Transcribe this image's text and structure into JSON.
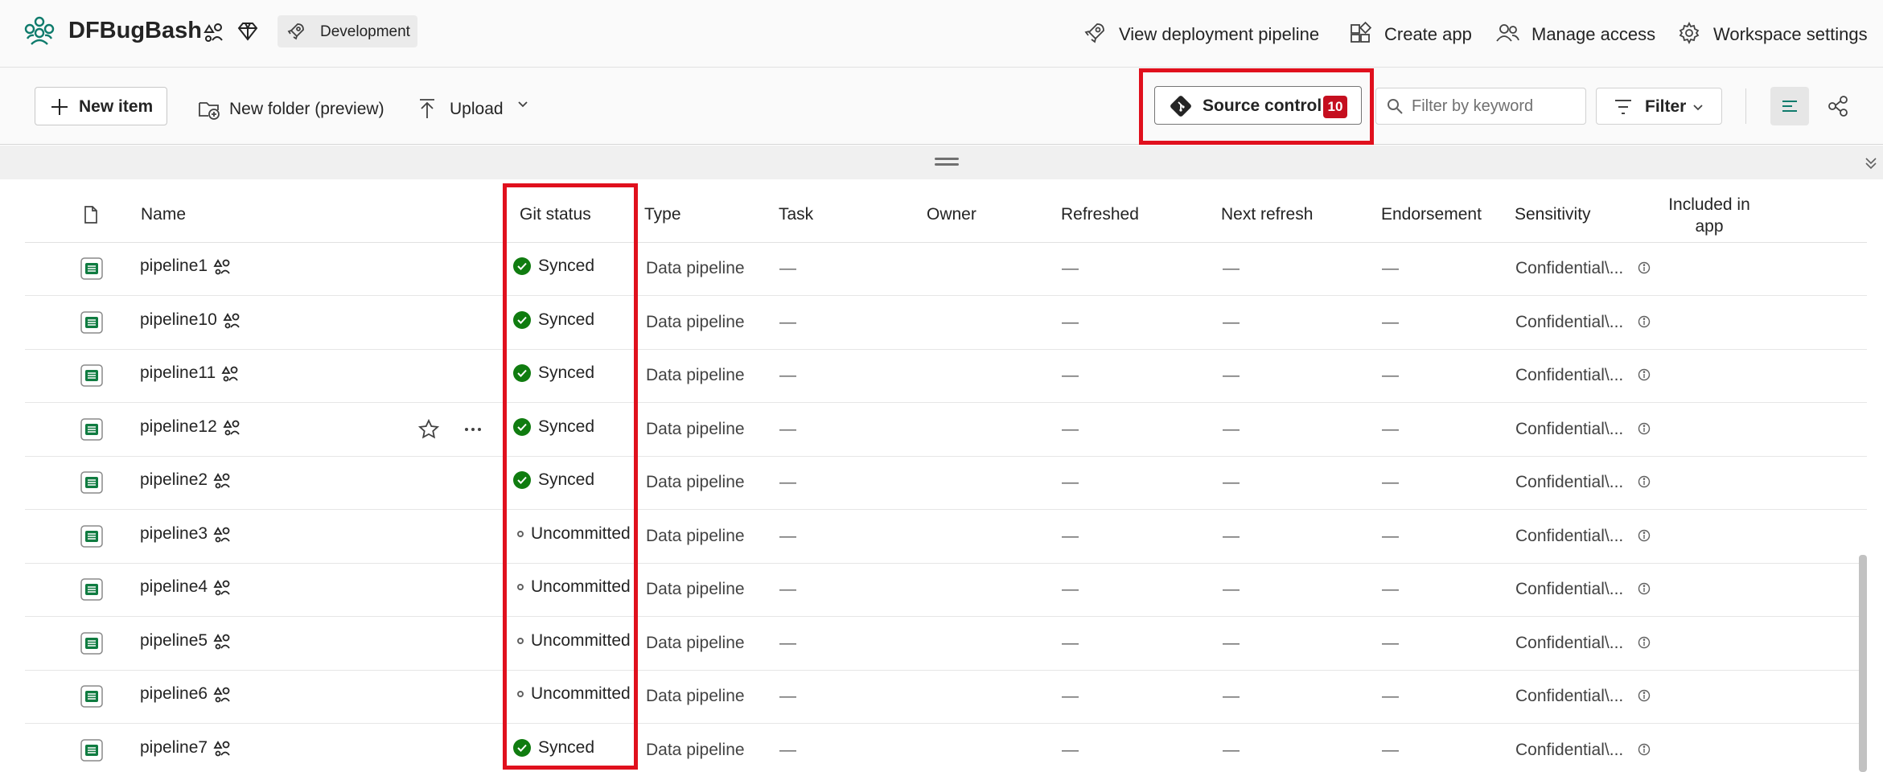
{
  "workspace": {
    "name": "DFBugBash",
    "environment": "Development"
  },
  "header_actions": [
    {
      "label": "View deployment pipeline",
      "icon": "rocket-icon"
    },
    {
      "label": "Create app",
      "icon": "app-icon"
    },
    {
      "label": "Manage access",
      "icon": "people-icon"
    },
    {
      "label": "Workspace settings",
      "icon": "gear-icon"
    }
  ],
  "toolbar": {
    "new_item": "New item",
    "new_folder": "New folder (preview)",
    "upload": "Upload",
    "source_control": "Source control",
    "source_control_count": "10",
    "filter_placeholder": "Filter by keyword",
    "filter": "Filter"
  },
  "columns": {
    "name": "Name",
    "git_status": "Git status",
    "type": "Type",
    "task": "Task",
    "owner": "Owner",
    "refreshed": "Refreshed",
    "next_refresh": "Next refresh",
    "endorsement": "Endorsement",
    "sensitivity": "Sensitivity",
    "included_in_app": "Included in app"
  },
  "rows": [
    {
      "name": "pipeline1",
      "git_status": "Synced",
      "type": "Data pipeline",
      "task": "—",
      "refreshed": "—",
      "next_refresh": "—",
      "endorsement": "—",
      "sensitivity": "Confidential\\..."
    },
    {
      "name": "pipeline10",
      "git_status": "Synced",
      "type": "Data pipeline",
      "task": "—",
      "refreshed": "—",
      "next_refresh": "—",
      "endorsement": "—",
      "sensitivity": "Confidential\\..."
    },
    {
      "name": "pipeline11",
      "git_status": "Synced",
      "type": "Data pipeline",
      "task": "—",
      "refreshed": "—",
      "next_refresh": "—",
      "endorsement": "—",
      "sensitivity": "Confidential\\..."
    },
    {
      "name": "pipeline12",
      "git_status": "Synced",
      "type": "Data pipeline",
      "task": "—",
      "refreshed": "—",
      "next_refresh": "—",
      "endorsement": "—",
      "sensitivity": "Confidential\\...",
      "hover": true
    },
    {
      "name": "pipeline2",
      "git_status": "Synced",
      "type": "Data pipeline",
      "task": "—",
      "refreshed": "—",
      "next_refresh": "—",
      "endorsement": "—",
      "sensitivity": "Confidential\\..."
    },
    {
      "name": "pipeline3",
      "git_status": "Uncommitted",
      "type": "Data pipeline",
      "task": "—",
      "refreshed": "—",
      "next_refresh": "—",
      "endorsement": "—",
      "sensitivity": "Confidential\\..."
    },
    {
      "name": "pipeline4",
      "git_status": "Uncommitted",
      "type": "Data pipeline",
      "task": "—",
      "refreshed": "—",
      "next_refresh": "—",
      "endorsement": "—",
      "sensitivity": "Confidential\\..."
    },
    {
      "name": "pipeline5",
      "git_status": "Uncommitted",
      "type": "Data pipeline",
      "task": "—",
      "refreshed": "—",
      "next_refresh": "—",
      "endorsement": "—",
      "sensitivity": "Confidential\\..."
    },
    {
      "name": "pipeline6",
      "git_status": "Uncommitted",
      "type": "Data pipeline",
      "task": "—",
      "refreshed": "—",
      "next_refresh": "—",
      "endorsement": "—",
      "sensitivity": "Confidential\\..."
    },
    {
      "name": "pipeline7",
      "git_status": "Synced",
      "type": "Data pipeline",
      "task": "—",
      "refreshed": "—",
      "next_refresh": "—",
      "endorsement": "—",
      "sensitivity": "Confidential\\..."
    }
  ],
  "colors": {
    "synced": "#107c10",
    "badge": "#c50f1f",
    "highlight": "#e0101d",
    "pipeline_icon": "#107c41"
  }
}
